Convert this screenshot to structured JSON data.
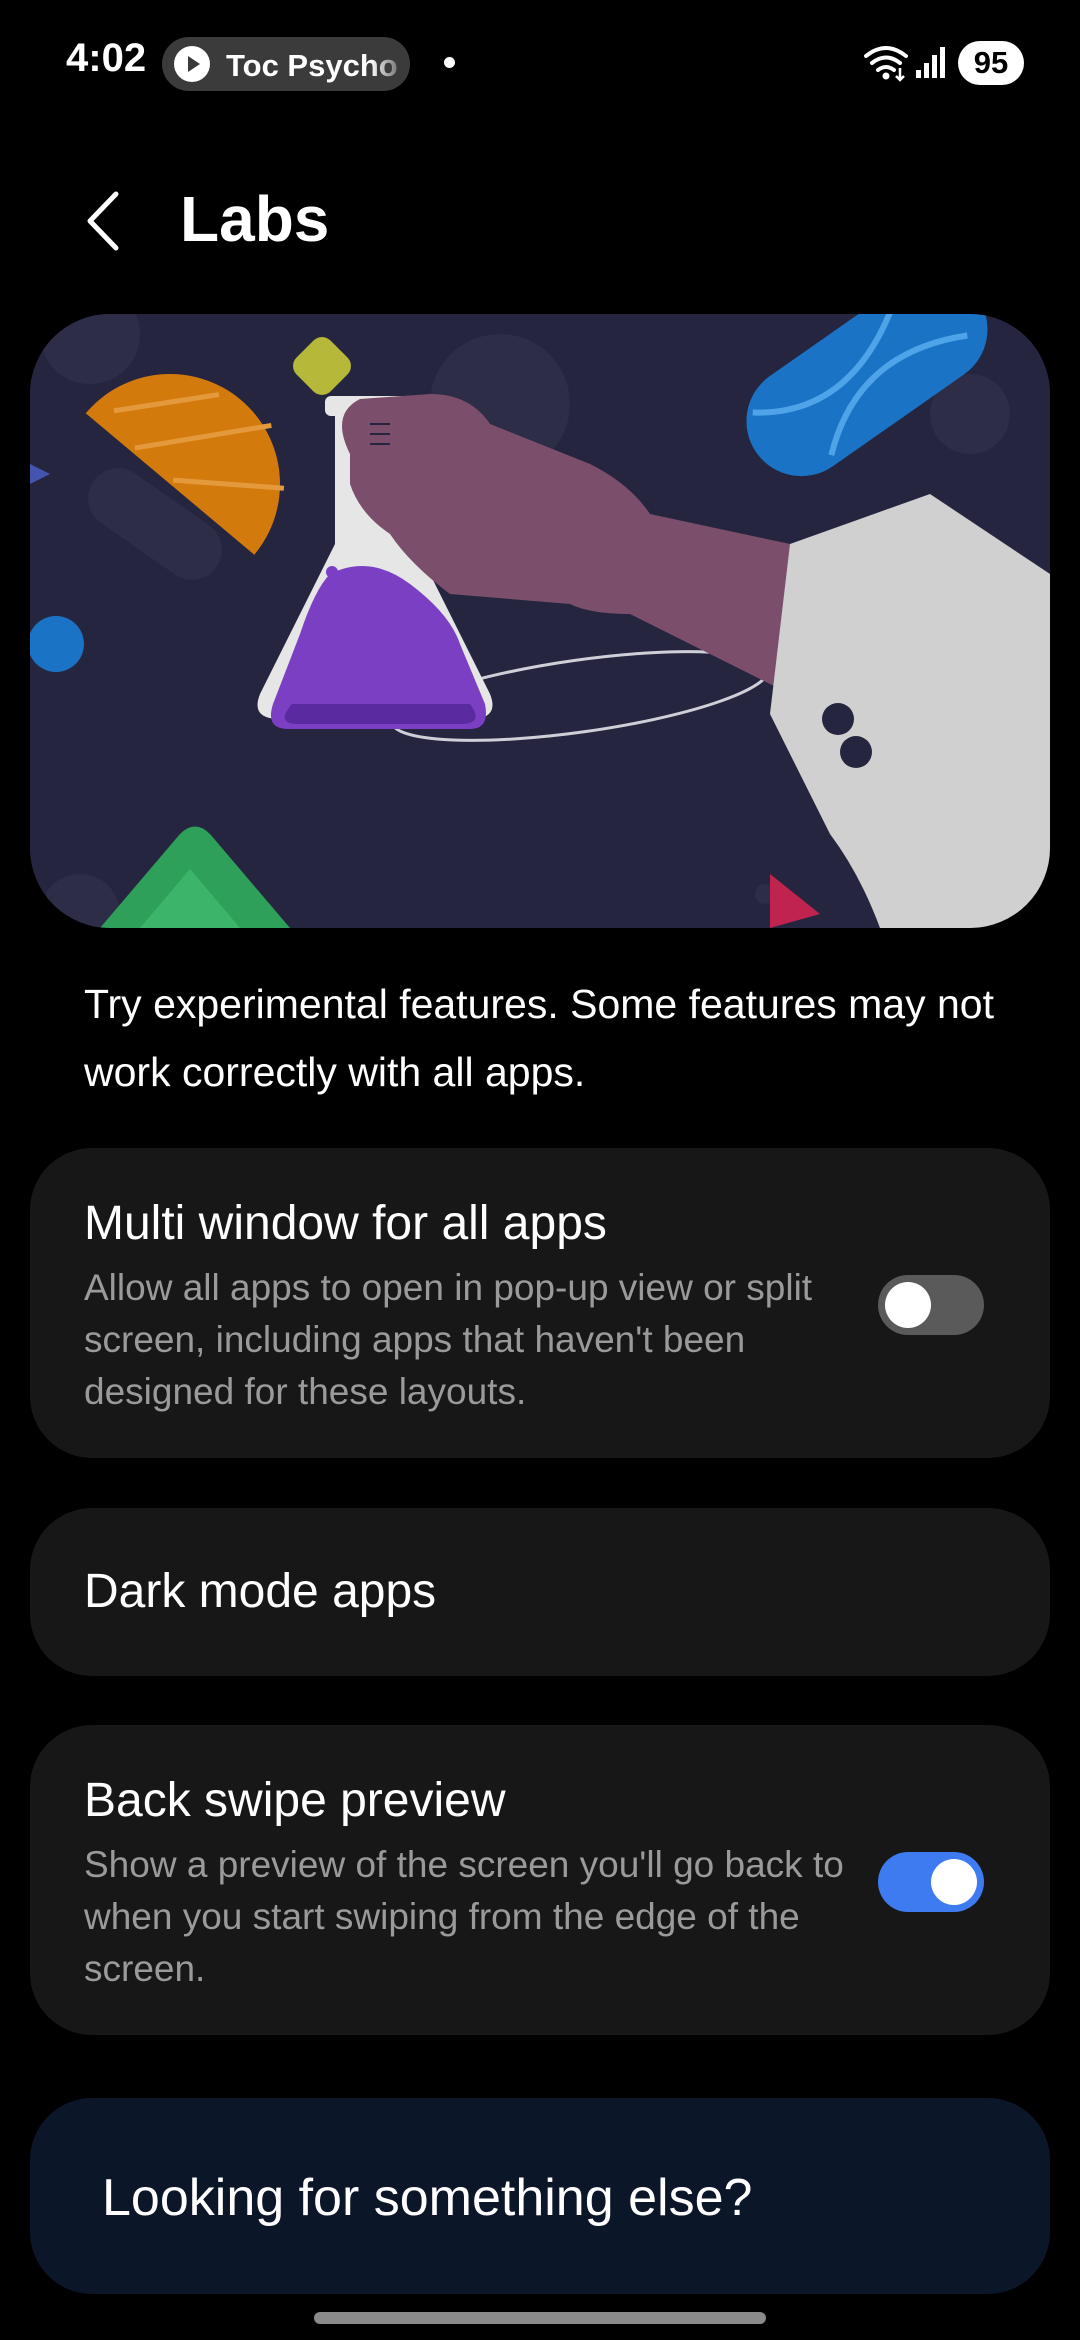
{
  "status_bar": {
    "time": "4:02",
    "media_text": "Toc Psycho",
    "battery": "95"
  },
  "header": {
    "title": "Labs"
  },
  "hero": {
    "icon": "lab-flask-illustration"
  },
  "description": "Try experimental features. Some features may not work correctly with all apps.",
  "settings": [
    {
      "title": "Multi window for all apps",
      "description": "Allow all apps to open in pop-up view or split screen, including apps that haven't been designed for these layouts.",
      "toggle": false
    },
    {
      "title": "Dark mode apps"
    },
    {
      "title": "Back swipe preview",
      "description": "Show a preview of the screen you'll go back to when you start swiping from the edge of the screen.",
      "toggle": true
    }
  ],
  "looking_for": "Looking for something else?",
  "colors": {
    "background": "#000000",
    "card": "#171717",
    "toggle_on": "#3e7bf0",
    "toggle_off": "#5a5a5a",
    "looking_card": "#0c1629"
  }
}
